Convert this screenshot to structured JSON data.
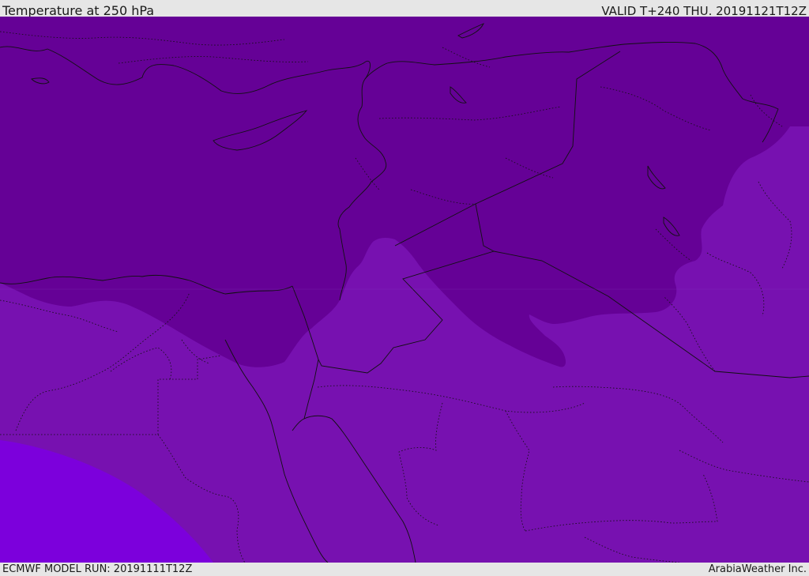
{
  "header": {
    "title": "Temperature at 250 hPa",
    "valid_time": "VALID T+240 THU. 20191121T12Z"
  },
  "footer": {
    "model_run": "ECMWF MODEL RUN: 20191111T12Z",
    "credit": "ArabiaWeather Inc."
  },
  "map": {
    "field": "temperature",
    "level": "250 hPa",
    "colors": {
      "coldest": "#650196",
      "mid": "#7711b0",
      "warmest": "#7c00dc",
      "border": "#111111"
    }
  }
}
